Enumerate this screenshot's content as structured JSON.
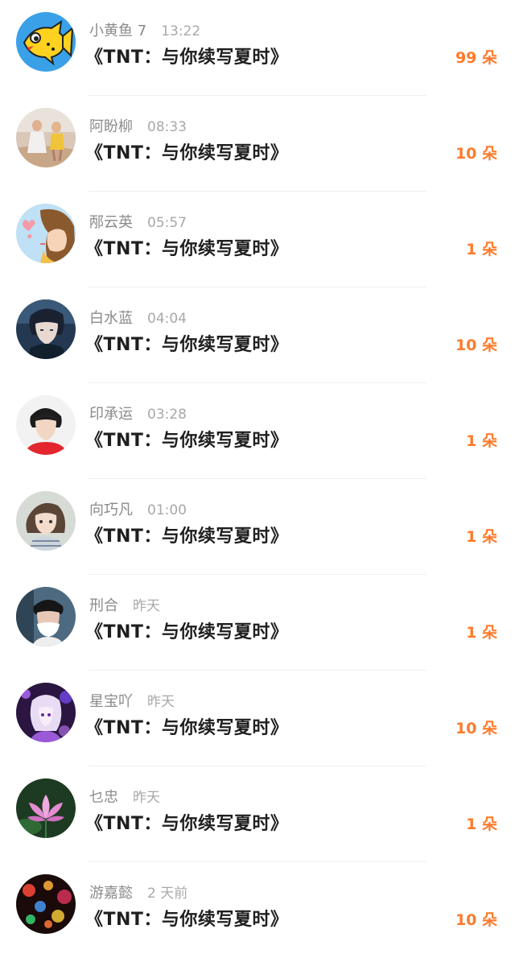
{
  "list": {
    "items": [
      {
        "name": "小黄鱼 7",
        "time": "13:22",
        "title": "《TNT：与你续写夏时》",
        "gift": "99 朵",
        "avatar": "fish-avatar-icon"
      },
      {
        "name": "阿盼柳",
        "time": "08:33",
        "title": "《TNT：与你续写夏时》",
        "gift": "10 朵",
        "avatar": "photo-avatar"
      },
      {
        "name": "邴云英",
        "time": "05:57",
        "title": "《TNT：与你续写夏时》",
        "gift": "1 朵",
        "avatar": "cartoon-girl-avatar"
      },
      {
        "name": "白水蓝",
        "time": "04:04",
        "title": "《TNT：与你续写夏时》",
        "gift": "10 朵",
        "avatar": "anime-boy-avatar"
      },
      {
        "name": "印承运",
        "time": "03:28",
        "title": "《TNT：与你续写夏时》",
        "gift": "1 朵",
        "avatar": "boy-photo-avatar"
      },
      {
        "name": "向巧凡",
        "time": "01:00",
        "title": "《TNT：与你续写夏时》",
        "gift": "1 朵",
        "avatar": "girl-photo-avatar"
      },
      {
        "name": "刑合",
        "time": "昨天",
        "title": "《TNT：与你续写夏时》",
        "gift": "1 朵",
        "avatar": "masked-boy-avatar"
      },
      {
        "name": "星宝吖",
        "time": "昨天",
        "title": "《TNT：与你续写夏时》",
        "gift": "10 朵",
        "avatar": "purple-anime-avatar"
      },
      {
        "name": "乜忠",
        "time": "昨天",
        "title": "《TNT：与你续写夏时》",
        "gift": "1 朵",
        "avatar": "lotus-avatar"
      },
      {
        "name": "游嘉懿",
        "time": "2 天前",
        "title": "《TNT：与你续写夏时》",
        "gift": "10 朵",
        "avatar": "bokeh-lights-avatar"
      }
    ]
  },
  "colors": {
    "gift": "#ff7a2b",
    "name": "#8a8a8a",
    "title": "#1f1f1f"
  }
}
